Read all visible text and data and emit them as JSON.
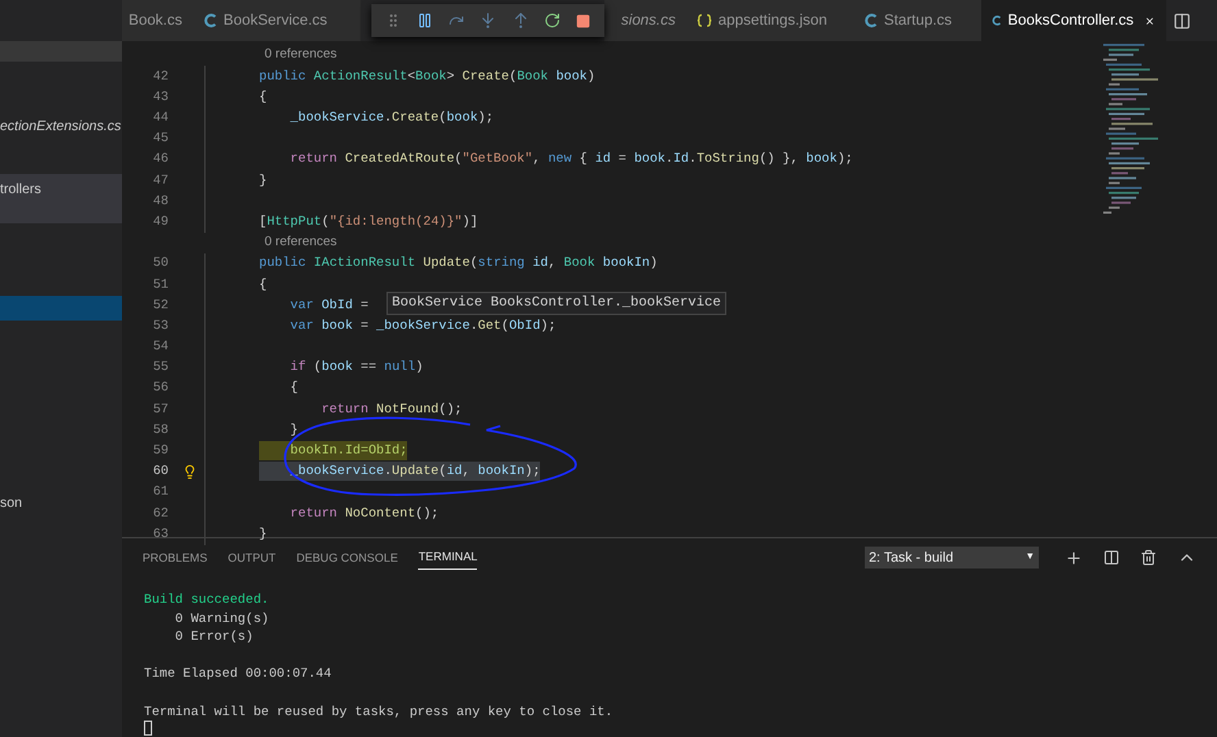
{
  "tabs": [
    {
      "label": "Book.cs",
      "kind": "plain",
      "selected": false
    },
    {
      "label": "BookService.cs",
      "kind": "csharp",
      "selected": false
    },
    {
      "label": "sions.cs",
      "kind": "plain",
      "selected": false
    },
    {
      "label": "appsettings.json",
      "kind": "json",
      "selected": false
    },
    {
      "label": "Startup.cs",
      "kind": "csharp",
      "selected": false
    },
    {
      "label": "BooksController.cs",
      "kind": "csharp",
      "selected": true
    }
  ],
  "sidebar": {
    "items": [
      {
        "label": "ectionExtensions.cs",
        "selected": false,
        "hovered": false
      },
      {
        "label": "trollers",
        "selected": false,
        "hovered": true
      },
      {
        "selected": true,
        "hovered": false
      },
      {
        "label": "son",
        "selected": false,
        "hovered": false
      }
    ]
  },
  "editor": {
    "lines": [
      {
        "kind": "codelens",
        "text": "0 references"
      },
      {
        "kind": "code",
        "number": "42",
        "tokens": [
          {
            "kind": "kw",
            "text": "public "
          },
          {
            "kind": "type",
            "text": "ActionResult"
          },
          {
            "kind": "plain",
            "text": "<"
          },
          {
            "kind": "type",
            "text": "Book"
          },
          {
            "kind": "plain",
            "text": "> "
          },
          {
            "kind": "method",
            "text": "Create"
          },
          {
            "kind": "plain",
            "text": "("
          },
          {
            "kind": "type",
            "text": "Book "
          },
          {
            "kind": "var",
            "text": "book"
          },
          {
            "kind": "plain",
            "text": ")"
          }
        ]
      },
      {
        "kind": "code",
        "number": "43",
        "tokens": [
          {
            "kind": "plain",
            "text": "{"
          }
        ]
      },
      {
        "kind": "code",
        "number": "44",
        "tokens": [
          {
            "kind": "var",
            "text": "    _bookService"
          },
          {
            "kind": "plain",
            "text": "."
          },
          {
            "kind": "method",
            "text": "Create"
          },
          {
            "kind": "plain",
            "text": "("
          },
          {
            "kind": "var",
            "text": "book"
          },
          {
            "kind": "plain",
            "text": ");"
          }
        ]
      },
      {
        "kind": "code",
        "number": "45"
      },
      {
        "kind": "code",
        "number": "46",
        "tokens": [
          {
            "kind": "ctrl",
            "text": "    return "
          },
          {
            "kind": "method",
            "text": "CreatedAtRoute"
          },
          {
            "kind": "plain",
            "text": "("
          },
          {
            "kind": "str",
            "text": "\"GetBook\""
          },
          {
            "kind": "plain",
            "text": ", "
          },
          {
            "kind": "kw",
            "text": "new"
          },
          {
            "kind": "plain",
            "text": " { "
          },
          {
            "kind": "var",
            "text": "id"
          },
          {
            "kind": "plain",
            "text": " = "
          },
          {
            "kind": "var",
            "text": "book"
          },
          {
            "kind": "plain",
            "text": "."
          },
          {
            "kind": "var",
            "text": "Id"
          },
          {
            "kind": "plain",
            "text": "."
          },
          {
            "kind": "method",
            "text": "ToString"
          },
          {
            "kind": "plain",
            "text": "() }, "
          },
          {
            "kind": "var",
            "text": "book"
          },
          {
            "kind": "plain",
            "text": ");"
          }
        ]
      },
      {
        "kind": "code",
        "number": "47",
        "tokens": [
          {
            "kind": "plain",
            "text": "}"
          }
        ]
      },
      {
        "kind": "code",
        "number": "48"
      },
      {
        "kind": "code",
        "number": "49",
        "tokens": [
          {
            "kind": "plain",
            "text": "["
          },
          {
            "kind": "type",
            "text": "HttpPut"
          },
          {
            "kind": "plain",
            "text": "("
          },
          {
            "kind": "str",
            "text": "\"{id:length(24)}\""
          },
          {
            "kind": "plain",
            "text": ")]"
          }
        ]
      },
      {
        "kind": "codelens",
        "text": "0 references"
      },
      {
        "kind": "code",
        "number": "50",
        "tokens": [
          {
            "kind": "kw",
            "text": "public "
          },
          {
            "kind": "type",
            "text": "IActionResult "
          },
          {
            "kind": "method",
            "text": "Update"
          },
          {
            "kind": "plain",
            "text": "("
          },
          {
            "kind": "kw",
            "text": "string "
          },
          {
            "kind": "var",
            "text": "id"
          },
          {
            "kind": "plain",
            "text": ", "
          },
          {
            "kind": "type",
            "text": "Book "
          },
          {
            "kind": "var",
            "text": "bookIn"
          },
          {
            "kind": "plain",
            "text": ")"
          }
        ]
      },
      {
        "kind": "code",
        "number": "51",
        "tokens": [
          {
            "kind": "plain",
            "text": "{"
          }
        ]
      },
      {
        "kind": "code",
        "number": "52",
        "tokens": [
          {
            "kind": "kw",
            "text": "    var "
          },
          {
            "kind": "var",
            "text": "ObId"
          },
          {
            "kind": "plain",
            "text": " ="
          }
        ],
        "tooltip": "BookService BooksController._bookService"
      },
      {
        "kind": "code",
        "number": "53",
        "tokens": [
          {
            "kind": "kw",
            "text": "    var "
          },
          {
            "kind": "var",
            "text": "book"
          },
          {
            "kind": "plain",
            "text": " = "
          },
          {
            "kind": "var",
            "text": "_bookService"
          },
          {
            "kind": "plain",
            "text": "."
          },
          {
            "kind": "method",
            "text": "Get"
          },
          {
            "kind": "plain",
            "text": "("
          },
          {
            "kind": "var",
            "text": "ObId"
          },
          {
            "kind": "plain",
            "text": ");"
          }
        ]
      },
      {
        "kind": "code",
        "number": "54"
      },
      {
        "kind": "code",
        "number": "55",
        "tokens": [
          {
            "kind": "ctrl",
            "text": "    if"
          },
          {
            "kind": "plain",
            "text": " ("
          },
          {
            "kind": "var",
            "text": "book"
          },
          {
            "kind": "plain",
            "text": " == "
          },
          {
            "kind": "kw",
            "text": "null"
          },
          {
            "kind": "plain",
            "text": ")"
          }
        ]
      },
      {
        "kind": "code",
        "number": "56",
        "tokens": [
          {
            "kind": "plain",
            "text": "    {"
          }
        ]
      },
      {
        "kind": "code",
        "number": "57",
        "tokens": [
          {
            "kind": "ctrl",
            "text": "        return "
          },
          {
            "kind": "method",
            "text": "NotFound"
          },
          {
            "kind": "plain",
            "text": "();"
          }
        ]
      },
      {
        "kind": "code",
        "number": "58",
        "tokens": [
          {
            "kind": "plain",
            "text": "    }"
          }
        ]
      },
      {
        "kind": "code",
        "number": "59",
        "highlighted": true,
        "tokens": [
          {
            "kind": "lime",
            "text": "    bookIn.Id=ObId;"
          }
        ]
      },
      {
        "kind": "code",
        "number": "60",
        "text_selected": true,
        "current": true,
        "lightbulb": true,
        "tokens": [
          {
            "kind": "var",
            "text": "    _bookService"
          },
          {
            "kind": "plain",
            "text": "."
          },
          {
            "kind": "method",
            "text": "Update"
          },
          {
            "kind": "plain",
            "text": "("
          },
          {
            "kind": "var",
            "text": "id"
          },
          {
            "kind": "plain",
            "text": ", "
          },
          {
            "kind": "var",
            "text": "bookIn"
          },
          {
            "kind": "plain",
            "text": ");"
          }
        ]
      },
      {
        "kind": "code",
        "number": "61"
      },
      {
        "kind": "code",
        "number": "62",
        "tokens": [
          {
            "kind": "ctrl",
            "text": "    return "
          },
          {
            "kind": "method",
            "text": "NoContent"
          },
          {
            "kind": "plain",
            "text": "();"
          }
        ]
      },
      {
        "kind": "code",
        "number": "63",
        "tokens": [
          {
            "kind": "plain",
            "text": "}"
          }
        ]
      }
    ]
  },
  "panel": {
    "tabs": [
      {
        "label": "PROBLEMS",
        "selected": false
      },
      {
        "label": "OUTPUT",
        "selected": false
      },
      {
        "label": "DEBUG CONSOLE",
        "selected": false
      },
      {
        "label": "TERMINAL",
        "selected": true
      }
    ],
    "terminal_select": {
      "value": "2: Task - build",
      "caret": "▼"
    },
    "terminal": [
      {
        "kind": "success",
        "text": "Build succeeded."
      },
      {
        "kind": "plain",
        "text": "    0 Warning(s)"
      },
      {
        "kind": "plain",
        "text": "    0 Error(s)"
      },
      {
        "kind": "blank"
      },
      {
        "kind": "plain",
        "text": "Time Elapsed 00:00:07.44"
      },
      {
        "kind": "blank"
      },
      {
        "kind": "plain",
        "text": "Terminal will be reused by tasks, press any key to close it."
      },
      {
        "kind": "cursor"
      }
    ]
  }
}
